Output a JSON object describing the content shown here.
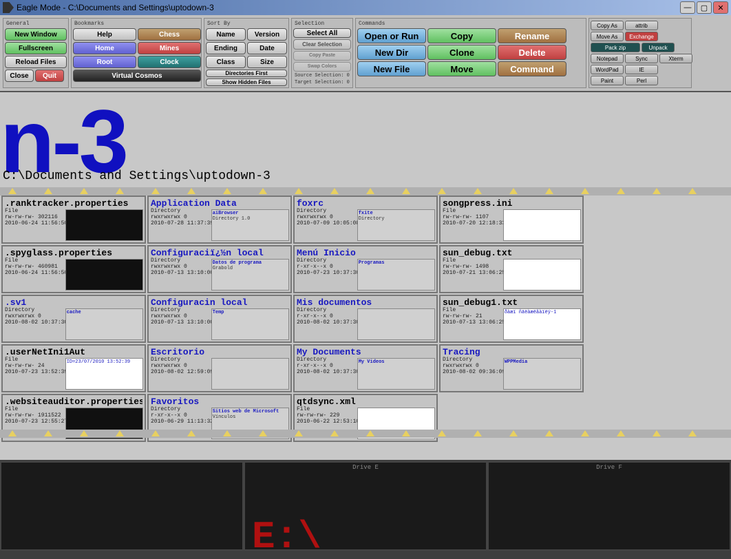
{
  "window": {
    "title": "Eagle Mode - C:\\Documents and Settings\\uptodown-3"
  },
  "toolbar": {
    "left": {
      "new_window": "New Window",
      "fullscreen": "Fullscreen",
      "reload": "Reload Files",
      "close": "Close",
      "quit": "Quit"
    },
    "nav": {
      "help": "Help",
      "home": "Home",
      "root": "Root",
      "virtual": "Virtual Cosmos",
      "chess": "Chess",
      "mines": "Mines",
      "clock": "Clock"
    },
    "sort": {
      "name": "Name",
      "version": "Version",
      "ending": "Ending",
      "date": "Date",
      "class": "Class",
      "size": "Size",
      "dirs_first": "Directories First",
      "show_hidden": "Show Hidden Files"
    },
    "select": {
      "all": "Select All",
      "clear": "Clear Selection",
      "src_sel": "Source Selection: 0",
      "tgt_sel": "Target Selection: 0"
    },
    "cmd": {
      "open": "Open or Run",
      "copy": "Copy",
      "rename": "Rename",
      "newdir": "New Dir",
      "clone": "Clone",
      "delete": "Delete",
      "newfile": "New File",
      "move": "Move",
      "command": "Command"
    },
    "right": {
      "copy_as": "Copy As",
      "attrib": "attrib",
      "move_as": "Move As",
      "exchange": "Exchange",
      "pack_zip": "Pack zip",
      "unpack": "Unpack",
      "notepad": "Notepad",
      "wordpad": "WordPad",
      "paint": "Paint"
    }
  },
  "path": "C:\\Documents and Settings\\uptodown-3",
  "big_title": "n-3",
  "tiles": [
    {
      "name": ".ranktracker.properties",
      "kind": "file",
      "meta1": "File",
      "meta2": "rw-rw-rw- 302116",
      "meta3": "2010-06-24 11:56:50",
      "preview": "dark"
    },
    {
      "name": "Application Data",
      "kind": "dir",
      "meta1": "Directory",
      "meta2": "rwxrwxrwx 0",
      "meta3": "2010-07-28 11:37:39",
      "sub": "aiBrowser",
      "sub2": "Directory   1.0"
    },
    {
      "name": "foxrc",
      "kind": "dir",
      "meta1": "Directory",
      "meta2": "rwxrwxrwx 0",
      "meta3": "2010-07-09 10:05:08",
      "sub": "fxite",
      "sub2": "Directory"
    },
    {
      "name": "songpress.ini",
      "kind": "file",
      "meta1": "File",
      "meta2": "rw-rw-rw- 1107",
      "meta3": "2010-07-20 12:18:33",
      "preview": "white"
    },
    {
      "name": ".spyglass.properties",
      "kind": "file",
      "meta1": "File",
      "meta2": "rw-rw-rw- 460981",
      "meta3": "2010-06-24 11:56:50",
      "preview": "dark"
    },
    {
      "name": "Configuraciï¿½n local",
      "kind": "dir",
      "meta1": "Directory",
      "meta2": "rwxrwxrwx 0",
      "meta3": "2010-07-13 13:10:00",
      "sub": "Datos de programa",
      "sub2": "Grabold"
    },
    {
      "name": "Menú Inicio",
      "kind": "dir",
      "meta1": "Directory",
      "meta2": "r-xr-x--x 0",
      "meta3": "2010-07-23 10:37:30",
      "sub": "Programas",
      "sub2": ""
    },
    {
      "name": "sun_debug.txt",
      "kind": "file",
      "meta1": "File",
      "meta2": "rw-rw-rw- 1498",
      "meta3": "2010-07-21 13:06:25",
      "preview": "white"
    },
    {
      "name": ".sv1",
      "kind": "dir",
      "meta1": "Directory",
      "meta2": "rwxrwxrwx 0",
      "meta3": "2010-08-02 10:37:30",
      "sub": "cache",
      "sub2": ""
    },
    {
      "name": "Configuracin local",
      "kind": "dir",
      "meta1": "Directory",
      "meta2": "rwxrwxrwx 0",
      "meta3": "2010-07-13 13:10:00",
      "sub": "Temp",
      "sub2": ""
    },
    {
      "name": "Mis documentos",
      "kind": "dir",
      "meta1": "Directory",
      "meta2": "r-xr-x--x 0",
      "meta3": "2010-08-02 10:37:30",
      "sub": "",
      "sub2": ""
    },
    {
      "name": "sun_debug1.txt",
      "kind": "file",
      "meta1": "File",
      "meta2": "rw-rw-rw- 21",
      "meta3": "2010-07-13 13:06:25",
      "content": "ðàæï ñäëàæëâàïëÿ-1"
    },
    {
      "name": ".userNetIni1Aut",
      "kind": "file",
      "meta1": "File",
      "meta2": "rw-rw-rw- 24",
      "meta3": "2010-07-23 13:52:39",
      "content": "ID=23/07/2010 13:52:39"
    },
    {
      "name": "Escritorio",
      "kind": "dir",
      "meta1": "Directory",
      "meta2": "rwxrwxrwx 0",
      "meta3": "2010-08-02 12:59:09",
      "sub": "",
      "sub2": ""
    },
    {
      "name": "My Documents",
      "kind": "dir",
      "meta1": "Directory",
      "meta2": "r-xr-x--x 0",
      "meta3": "2010-08-02 10:37:30",
      "sub": "My Videos",
      "sub2": ""
    },
    {
      "name": "Tracing",
      "kind": "dir",
      "meta1": "Directory",
      "meta2": "rwxrwxrwx 0",
      "meta3": "2010-08-02 09:36:09",
      "sub": "WPPMedia",
      "sub2": ""
    },
    {
      "name": ".websiteauditor.properties",
      "kind": "file",
      "meta1": "File",
      "meta2": "rw-rw-rw- 1911522",
      "meta3": "2010-07-23 12:55:27",
      "preview": "dark"
    },
    {
      "name": "Favoritos",
      "kind": "dir",
      "meta1": "Directory",
      "meta2": "r-xr-x--x 0",
      "meta3": "2010-06-29 11:13:32",
      "sub": "Sitios web de Microsoft",
      "sub2": "Vínculos"
    },
    {
      "name": "qtdsync.xml",
      "kind": "file",
      "meta1": "File",
      "meta2": "rw-rw-rw- 229",
      "meta3": "2010-06-22 12:53:10",
      "preview": "white"
    }
  ],
  "drives": [
    {
      "label": "",
      "letter": ""
    },
    {
      "label": "Drive E",
      "letter": "E:\\"
    },
    {
      "label": "Drive F",
      "letter": ""
    }
  ]
}
